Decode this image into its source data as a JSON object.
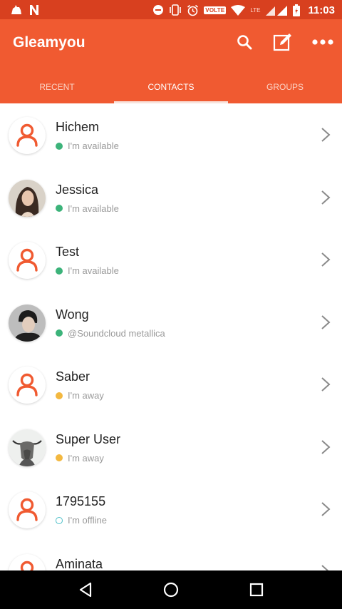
{
  "status_bar": {
    "time": "11:03",
    "volte": "VOLTE",
    "lte": "LTE",
    "icons": [
      "cat-notification-icon",
      "n-notification-icon",
      "dnd-icon",
      "vibrate-icon",
      "alarm-icon",
      "wifi-icon",
      "signal-icon",
      "battery-icon"
    ]
  },
  "app_bar": {
    "title": "Gleamyou",
    "actions": [
      "search-icon",
      "compose-icon",
      "more-icon"
    ]
  },
  "tabs": [
    {
      "label": "RECENT",
      "active": false
    },
    {
      "label": "CONTACTS",
      "active": true
    },
    {
      "label": "GROUPS",
      "active": false
    }
  ],
  "colors": {
    "primary": "#f05a31",
    "status_bar": "#d8401f",
    "available": "#3cb37a",
    "away": "#f3b840",
    "offline": "#4dbfc8"
  },
  "contacts": [
    {
      "name": "Hichem",
      "status": "I'm available",
      "presence": "available",
      "avatar": "default"
    },
    {
      "name": "Jessica",
      "status": "I'm available",
      "presence": "available",
      "avatar": "photo-woman"
    },
    {
      "name": "Test",
      "status": "I'm available",
      "presence": "available",
      "avatar": "default"
    },
    {
      "name": "Wong",
      "status": "@Soundcloud metallica",
      "presence": "available",
      "avatar": "photo-man"
    },
    {
      "name": "Saber",
      "status": "I'm away",
      "presence": "away",
      "avatar": "default"
    },
    {
      "name": "Super User",
      "status": "I'm away",
      "presence": "away",
      "avatar": "photo-yak"
    },
    {
      "name": "1795155",
      "status": "I'm offline",
      "presence": "offline",
      "avatar": "default"
    },
    {
      "name": "Aminata",
      "status": "",
      "presence": "",
      "avatar": "default"
    }
  ],
  "nav_bar": [
    "back-icon",
    "home-icon",
    "recents-icon"
  ]
}
